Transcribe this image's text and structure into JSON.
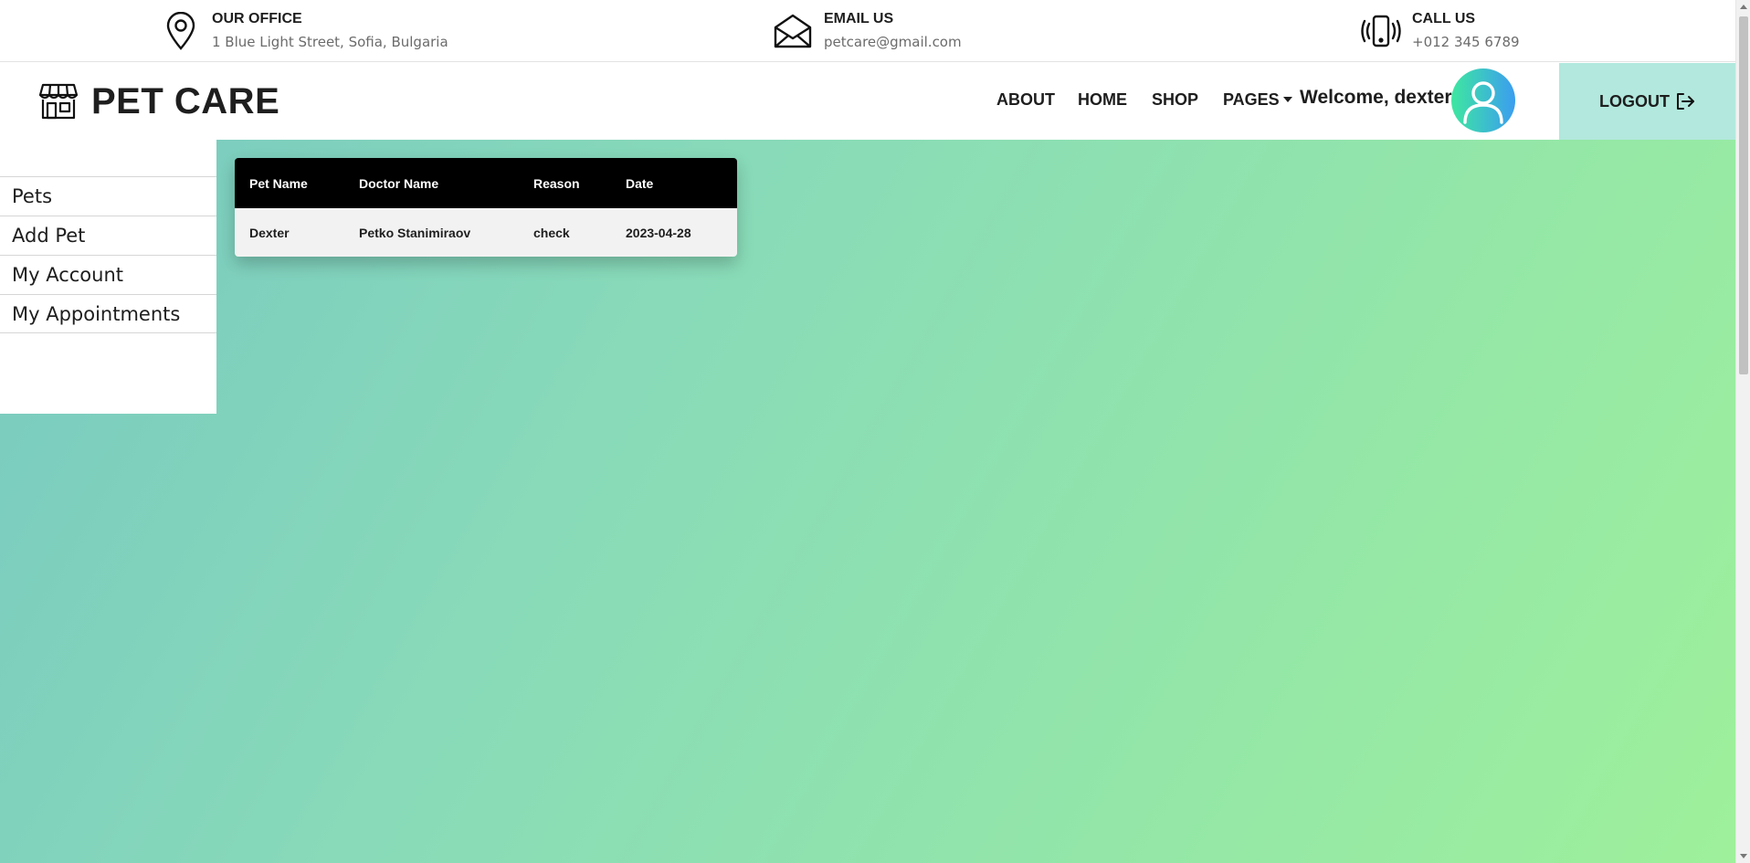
{
  "topbar": {
    "office": {
      "title": "OUR OFFICE",
      "value": "1 Blue Light Street, Sofia, Bulgaria",
      "icon": "map-pin-icon"
    },
    "email": {
      "title": "EMAIL US",
      "value": "petcare@gmail.com",
      "icon": "envelope-icon"
    },
    "call": {
      "title": "CALL US",
      "value": "+012 345 6789",
      "icon": "phone-vibrate-icon"
    }
  },
  "navbar": {
    "brand": "PET CARE",
    "brand_icon": "shop-icon",
    "links": {
      "about": "ABOUT",
      "home": "HOME",
      "shop": "SHOP",
      "pages": "PAGES"
    },
    "welcome": "Welcome, dexter",
    "logout": "LOGOUT",
    "logout_icon": "logout-arrow-icon"
  },
  "sidebar": {
    "items": [
      {
        "label": "Pets"
      },
      {
        "label": "Add Pet"
      },
      {
        "label": "My Account"
      },
      {
        "label": "My Appointments"
      }
    ]
  },
  "appointments": {
    "columns": [
      "Pet Name",
      "Doctor Name",
      "Reason",
      "Date"
    ],
    "rows": [
      [
        "Dexter",
        "Petko Stanimiraov",
        "check",
        "2023-04-28"
      ]
    ]
  },
  "colors": {
    "accent_logout_bg": "#b2e8dd",
    "gradient_start": "#78c9c0",
    "gradient_end": "#9ef09b",
    "table_header_bg": "#000000"
  }
}
